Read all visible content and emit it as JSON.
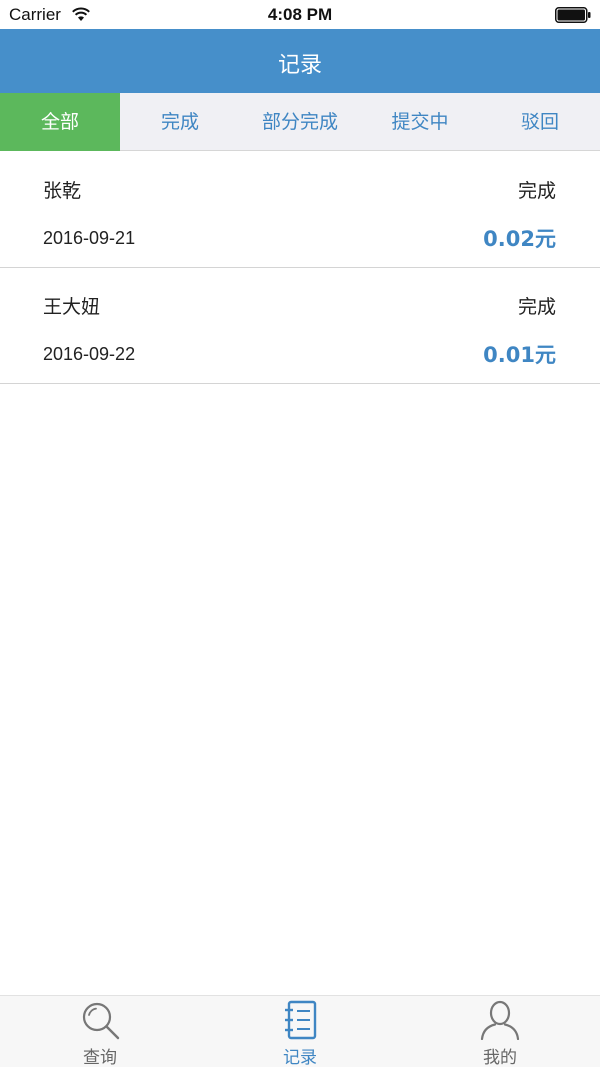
{
  "status_bar": {
    "carrier": "Carrier",
    "time": "4:08 PM",
    "icons": [
      "wifi-icon",
      "battery-icon"
    ]
  },
  "nav": {
    "title": "记录"
  },
  "filter_tabs": [
    {
      "label": "全部",
      "active": true
    },
    {
      "label": "完成",
      "active": false
    },
    {
      "label": "部分完成",
      "active": false
    },
    {
      "label": "提交中",
      "active": false
    },
    {
      "label": "驳回",
      "active": false
    }
  ],
  "records": [
    {
      "name": "张乾",
      "status": "完成",
      "date": "2016-09-21",
      "amount": "0.02元"
    },
    {
      "name": "王大妞",
      "status": "完成",
      "date": "2016-09-22",
      "amount": "0.01元"
    }
  ],
  "tab_bar": {
    "items": [
      {
        "label": "查询",
        "icon": "search-icon",
        "active": false
      },
      {
        "label": "记录",
        "icon": "notebook-icon",
        "active": true
      },
      {
        "label": "我的",
        "icon": "user-icon",
        "active": false
      }
    ]
  },
  "colors": {
    "nav_bg": "#468fca",
    "active_tab_bg": "#5cb85c",
    "accent": "#3f86c3",
    "tab_strip_bg": "#f0f0f4"
  }
}
